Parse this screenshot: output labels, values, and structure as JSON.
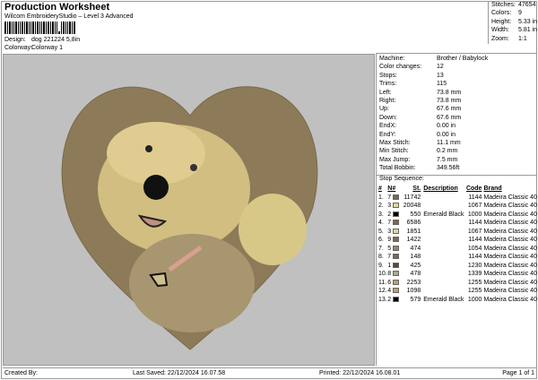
{
  "header": {
    "title": "Production Worksheet",
    "subtitle": "Wilcom EmbroideryStudio – Level 3 Advanced",
    "design_label": "Design:",
    "design": "dog 221224 5,8in",
    "colorway_label": "Colorway:",
    "colorway": "Colorway 1"
  },
  "stats": [
    {
      "k": "Stitches:",
      "v": "47654"
    },
    {
      "k": "Colors:",
      "v": "9"
    },
    {
      "k": "Height:",
      "v": "5.33 in"
    },
    {
      "k": "Width:",
      "v": "5.81 in"
    },
    {
      "k": "Zoom:",
      "v": "1:1"
    }
  ],
  "machine_info": [
    {
      "k": "Machine:",
      "v": "Brother / Babylock"
    },
    {
      "k": "Color changes:",
      "v": "12"
    },
    {
      "k": "Stops:",
      "v": "13"
    },
    {
      "k": "Trims:",
      "v": "115"
    },
    {
      "k": "Left:",
      "v": "73.8 mm"
    },
    {
      "k": "Right:",
      "v": "73.8 mm"
    },
    {
      "k": "Up:",
      "v": "67.6 mm"
    },
    {
      "k": "Down:",
      "v": "67.6 mm"
    },
    {
      "k": "EndX:",
      "v": "0.00 in"
    },
    {
      "k": "EndY:",
      "v": "0.00 in"
    },
    {
      "k": "Max Stitch:",
      "v": "11.1 mm"
    },
    {
      "k": "Min Stitch:",
      "v": "0.2 mm"
    },
    {
      "k": "Max Jump:",
      "v": "7.5 mm"
    },
    {
      "k": "Total Bobbin:",
      "v": "349.56ft"
    }
  ],
  "stop_sequence": {
    "title": "Stop Sequence:",
    "headers": [
      "#",
      "N#",
      "St.",
      "Description",
      "Code",
      "Brand"
    ],
    "rows": [
      {
        "n": "1.",
        "nn": "7",
        "color": "#7d6650",
        "st": "11742",
        "desc": "",
        "code": "1144",
        "brand": "Madeira Classic 40"
      },
      {
        "n": "2.",
        "nn": "3",
        "color": "#e8d49a",
        "st": "20048",
        "desc": "",
        "code": "1067",
        "brand": "Madeira Classic 40"
      },
      {
        "n": "3.",
        "nn": "2",
        "color": "#000000",
        "st": "550",
        "desc": "Emerald Black",
        "code": "1000",
        "brand": "Madeira Classic 40"
      },
      {
        "n": "4.",
        "nn": "7",
        "color": "#7d6650",
        "st": "6586",
        "desc": "",
        "code": "1144",
        "brand": "Madeira Classic 40"
      },
      {
        "n": "5.",
        "nn": "3",
        "color": "#e8d49a",
        "st": "1851",
        "desc": "",
        "code": "1067",
        "brand": "Madeira Classic 40"
      },
      {
        "n": "6.",
        "nn": "9",
        "color": "#7d6650",
        "st": "1422",
        "desc": "",
        "code": "1144",
        "brand": "Madeira Classic 40"
      },
      {
        "n": "7.",
        "nn": "5",
        "color": "#a07e6e",
        "st": "474",
        "desc": "",
        "code": "1054",
        "brand": "Madeira Classic 40"
      },
      {
        "n": "8.",
        "nn": "7",
        "color": "#7d6650",
        "st": "148",
        "desc": "",
        "code": "1144",
        "brand": "Madeira Classic 40"
      },
      {
        "n": "9.",
        "nn": "1",
        "color": "#5b4535",
        "st": "425",
        "desc": "",
        "code": "1230",
        "brand": "Madeira Classic 40"
      },
      {
        "n": "10.",
        "nn": "8",
        "color": "#a9a994",
        "st": "478",
        "desc": "",
        "code": "1339",
        "brand": "Madeira Classic 40"
      },
      {
        "n": "11.",
        "nn": "6",
        "color": "#c69a68",
        "st": "2253",
        "desc": "",
        "code": "1255",
        "brand": "Madeira Classic 40"
      },
      {
        "n": "12.",
        "nn": "4",
        "color": "#c69a68",
        "st": "1098",
        "desc": "",
        "code": "1255",
        "brand": "Madeira Classic 40"
      },
      {
        "n": "13.",
        "nn": "2",
        "color": "#000000",
        "st": "579",
        "desc": "Emerald Black",
        "code": "1000",
        "brand": "Madeira Classic 40"
      }
    ]
  },
  "footer": {
    "created": "Created By:",
    "saved": "Last Saved: 22/12/2024 16.07.58",
    "printed": "Printed: 22/12/2024 16.08.01",
    "page": "Page 1 of 1"
  }
}
